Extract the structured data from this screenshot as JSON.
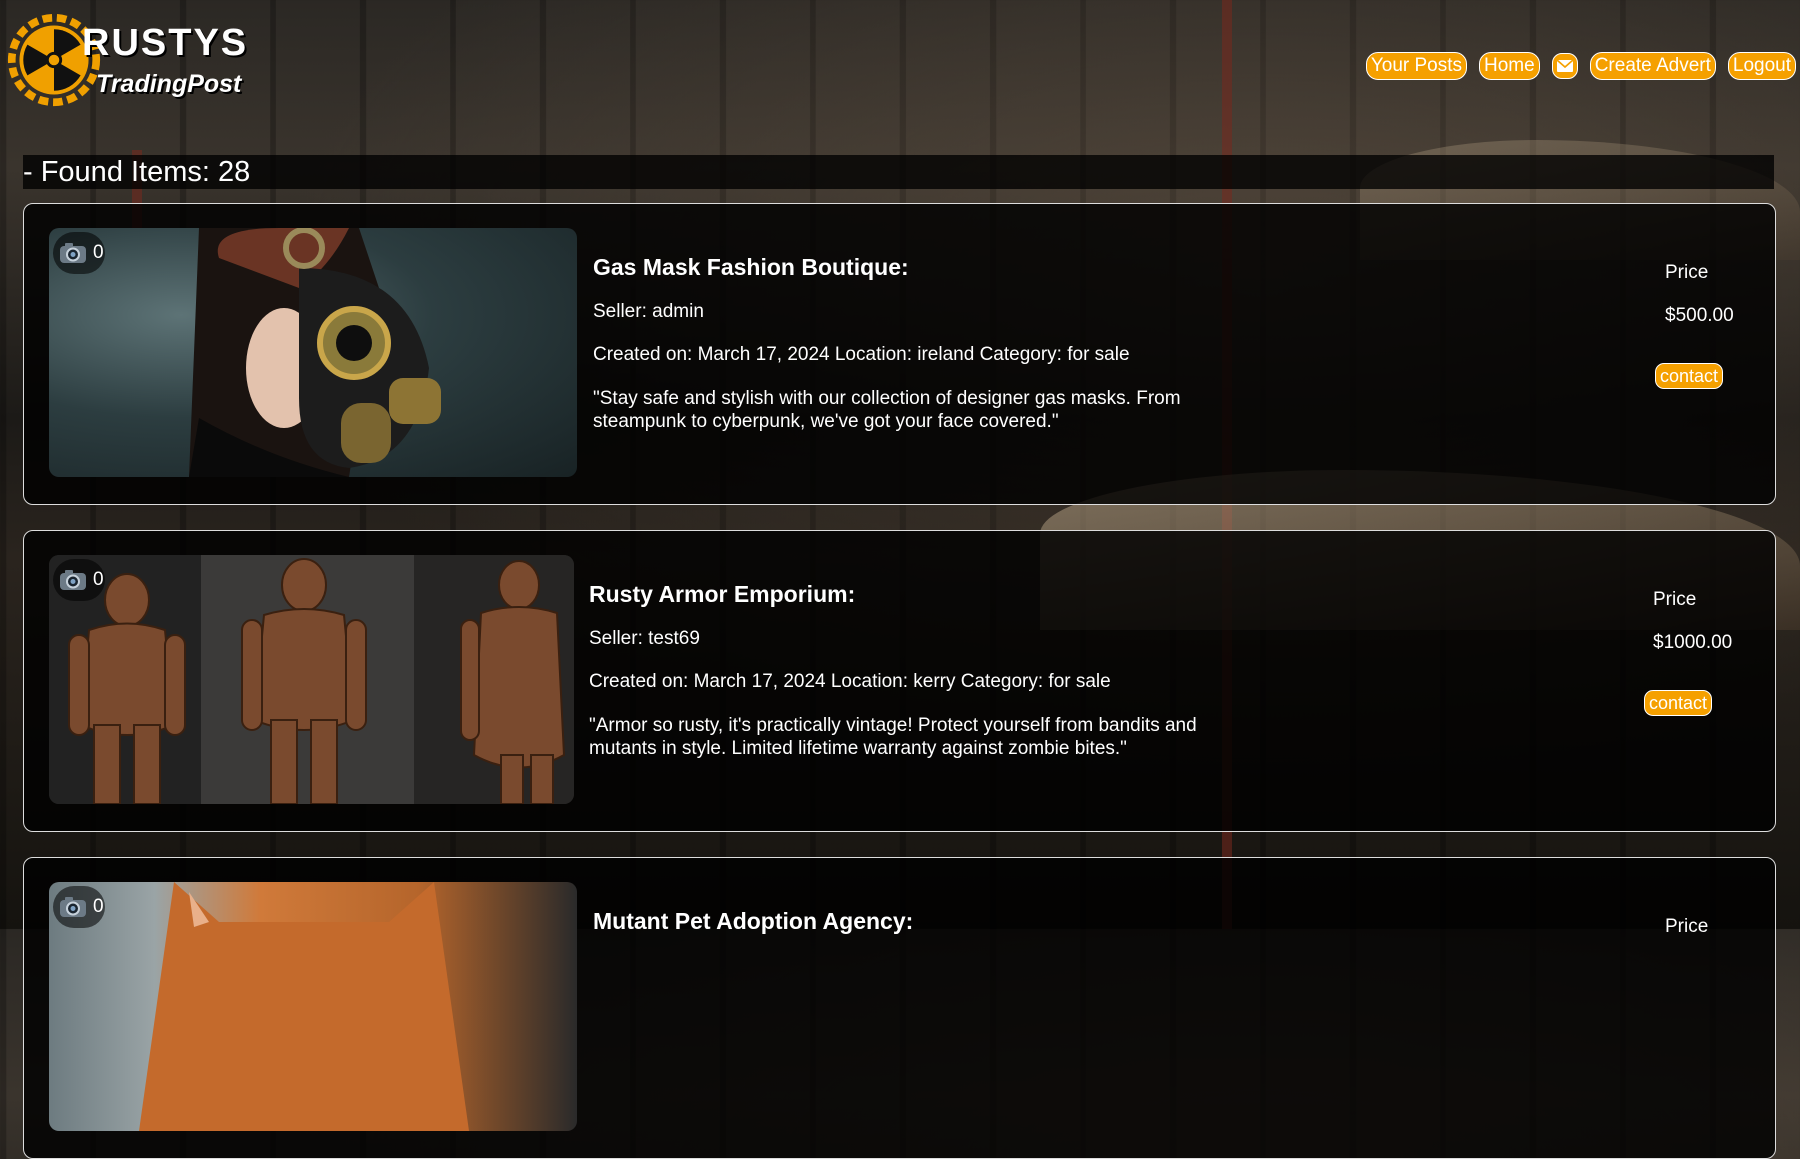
{
  "brand": {
    "title": "RUSTYS",
    "subtitle": "TradingPost"
  },
  "nav": {
    "your_posts": "Your Posts",
    "home": "Home",
    "create_advert": "Create Advert",
    "logout": "Logout"
  },
  "found_text": "- Found Items: 28",
  "listings": [
    {
      "title": "Gas Mask Fashion Boutique:",
      "seller": "Seller: admin",
      "meta": "Created on: March 17, 2024 Location: ireland Category: for sale",
      "description": "\"Stay safe and stylish with our collection of designer gas masks. From steampunk to cyberpunk, we've got your face covered.\"",
      "price_label": "Price",
      "price": "$500.00",
      "contact": "contact",
      "image_count": "0"
    },
    {
      "title": "Rusty Armor Emporium:",
      "seller": "Seller: test69",
      "meta": "Created on: March 17, 2024 Location: kerry Category: for sale",
      "description": "\"Armor so rusty, it's practically vintage! Protect yourself from bandits and mutants in style. Limited lifetime warranty against zombie bites.\"",
      "price_label": "Price",
      "price": "$1000.00",
      "contact": "contact",
      "image_count": "0"
    },
    {
      "title": "Mutant Pet Adoption Agency:",
      "price_label": "Price",
      "image_count": "0"
    }
  ],
  "colors": {
    "accent": "#f5a000",
    "card_bg": "#000000",
    "text": "#ffffff"
  },
  "icons": {
    "logo": "radiation-gear-icon",
    "mail": "envelope-icon",
    "camera": "camera-icon"
  }
}
